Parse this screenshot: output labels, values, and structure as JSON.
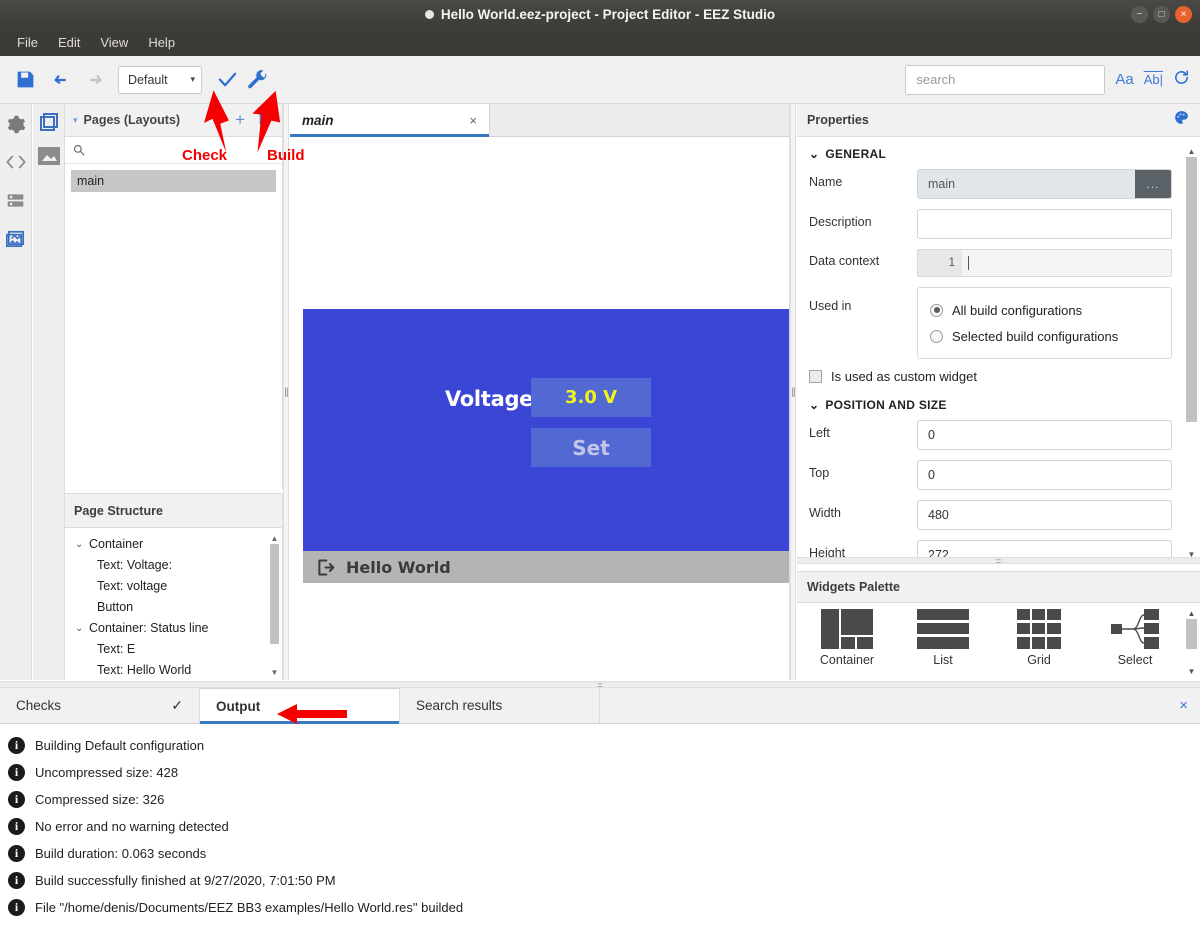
{
  "window": {
    "title": "Hello World.eez-project - Project Editor - EEZ Studio",
    "minimize": "−",
    "maximize": "□",
    "close": "×"
  },
  "menu": {
    "items": [
      "File",
      "Edit",
      "View",
      "Help"
    ]
  },
  "toolbar": {
    "save_icon": "save-icon",
    "undo_icon": "undo-icon",
    "redo_icon": "redo-icon",
    "configuration": "Default",
    "caret": "▾",
    "check_icon": "check-icon",
    "build_icon": "wrench-icon",
    "search_placeholder": "search",
    "match_case_label": "Aa",
    "whole_word_label": "Ab|",
    "refresh_icon": "refresh-icon"
  },
  "annotations": [
    {
      "label": "Check"
    },
    {
      "label": "Build"
    },
    {
      "label": "output-arrow"
    }
  ],
  "rail": {
    "items": [
      "gear-icon",
      "code-icon",
      "list-icon",
      "images-icon"
    ]
  },
  "rail2": {
    "items": [
      "pages-icon",
      "image-icon"
    ]
  },
  "pages_panel": {
    "title": "Pages (Layouts)",
    "collapse_caret": "▾",
    "add_label": "+",
    "delete_icon": "trash-icon",
    "search_icon": "search-icon",
    "items": [
      "main"
    ]
  },
  "page_structure": {
    "title": "Page Structure",
    "nodes": [
      {
        "label": "Container",
        "indent": 0,
        "chevron": "⌄"
      },
      {
        "label": "Text: Voltage:",
        "indent": 1,
        "chevron": ""
      },
      {
        "label": "Text: voltage",
        "indent": 1,
        "chevron": ""
      },
      {
        "label": "Button",
        "indent": 1,
        "chevron": ""
      },
      {
        "label": "Container: Status line",
        "indent": 0,
        "chevron": "⌄"
      },
      {
        "label": "Text: E",
        "indent": 1,
        "chevron": ""
      },
      {
        "label": "Text: Hello World",
        "indent": 1,
        "chevron": ""
      }
    ]
  },
  "editor": {
    "tab_label": "main",
    "tab_close": "×",
    "preview": {
      "voltage_label": "Voltage:",
      "voltage_value": "3.0 V",
      "set_button": "Set",
      "status_text": "Hello World",
      "status_icon": "exit-icon",
      "screen_color": "#3b45d6",
      "box_color": "#5268d2",
      "value_color": "#f3f51a",
      "status_bg": "#b4b4b4"
    }
  },
  "properties": {
    "title": "Properties",
    "theme_icon": "palette-icon",
    "general_section": {
      "title": "GENERAL",
      "chevron": "⌄",
      "name_label": "Name",
      "name_value": "main",
      "name_button": "...",
      "description_label": "Description",
      "description_value": "",
      "data_context_label": "Data context",
      "data_context_line_number": "1",
      "data_context_value": "",
      "used_in_label": "Used in",
      "radio_all": "All build configurations",
      "radio_selected": "Selected build configurations",
      "radio_selected_index": 0,
      "custom_widget_label": "Is used as custom widget",
      "custom_widget_checked": false
    },
    "position_section": {
      "title": "POSITION AND SIZE",
      "chevron": "⌄",
      "fields": [
        {
          "label": "Left",
          "value": "0"
        },
        {
          "label": "Top",
          "value": "0"
        },
        {
          "label": "Width",
          "value": "480"
        },
        {
          "label": "Height",
          "value": "272"
        }
      ]
    }
  },
  "palette": {
    "title": "Widgets Palette",
    "items": [
      {
        "label": "Container",
        "icon": "container-icon"
      },
      {
        "label": "List",
        "icon": "list-widget-icon"
      },
      {
        "label": "Grid",
        "icon": "grid-icon"
      },
      {
        "label": "Select",
        "icon": "select-icon"
      }
    ]
  },
  "bottom_panel": {
    "tabs": [
      {
        "label": "Checks",
        "active": false,
        "badge": "✓"
      },
      {
        "label": "Output",
        "active": true,
        "badge": ""
      },
      {
        "label": "Search results",
        "active": false,
        "badge": ""
      }
    ],
    "close_label": "×",
    "log": [
      {
        "icon": "info-icon",
        "text": "Building Default configuration"
      },
      {
        "icon": "info-icon",
        "text": "Uncompressed size: 428"
      },
      {
        "icon": "info-icon",
        "text": "Compressed size: 326"
      },
      {
        "icon": "info-icon",
        "text": "No error and no warning detected"
      },
      {
        "icon": "info-icon",
        "text": "Build duration: 0.063 seconds"
      },
      {
        "icon": "info-icon",
        "text": "Build successfully finished at 9/27/2020, 7:01:50 PM"
      },
      {
        "icon": "info-icon",
        "text": "File \"/home/denis/Documents/EEZ BB3 examples/Hello World.res\" builded"
      }
    ]
  }
}
